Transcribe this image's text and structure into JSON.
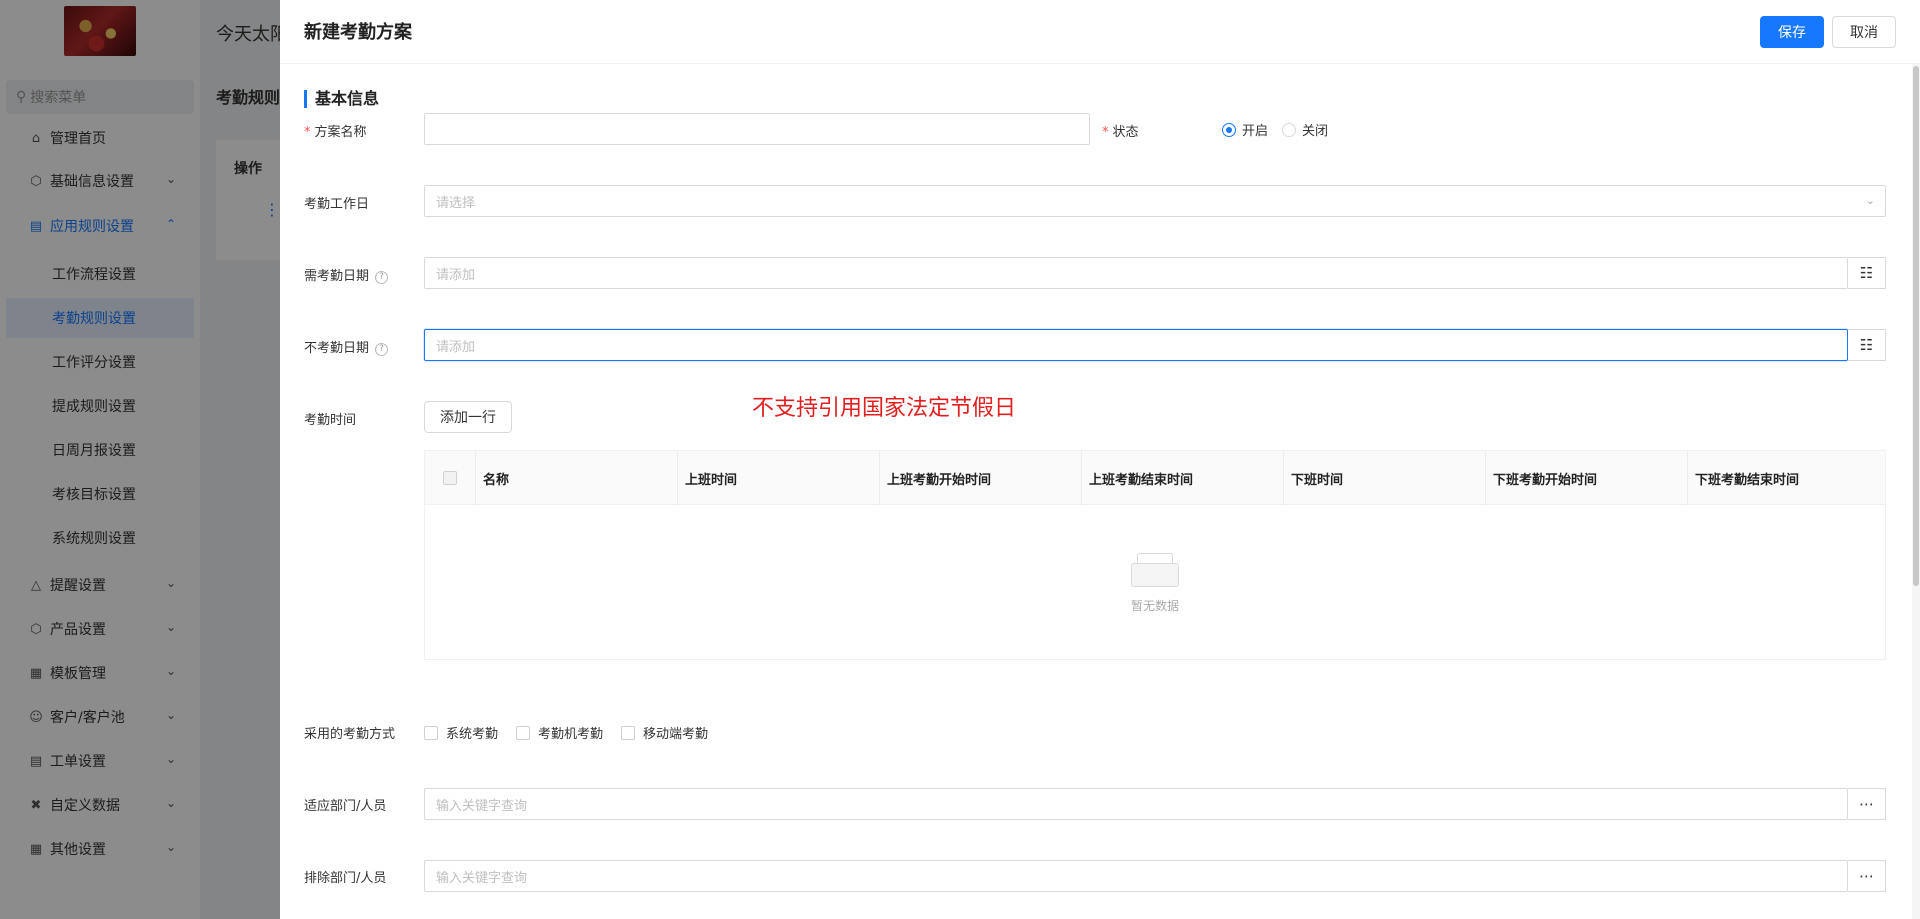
{
  "app": {
    "greeting": "今天太阳",
    "search_placeholder": "搜索菜单",
    "page_title": "考勤规则",
    "table_header_op": "操作",
    "row_action": "⋮"
  },
  "sidebar": {
    "items": [
      {
        "label": "管理首页",
        "icon": "home-icon"
      },
      {
        "label": "基础信息设置",
        "icon": "cube-icon"
      },
      {
        "label": "应用规则设置",
        "icon": "document-icon"
      },
      {
        "label": "提醒设置",
        "icon": "bell-icon"
      },
      {
        "label": "产品设置",
        "icon": "cube-icon"
      },
      {
        "label": "模板管理",
        "icon": "template-icon"
      },
      {
        "label": "客户/客户池",
        "icon": "user-icon"
      },
      {
        "label": "工单设置",
        "icon": "ticket-icon"
      },
      {
        "label": "自定义数据",
        "icon": "tools-icon"
      },
      {
        "label": "其他设置",
        "icon": "grid-icon"
      }
    ],
    "sub_items": [
      {
        "label": "工作流程设置"
      },
      {
        "label": "考勤规则设置"
      },
      {
        "label": "工作评分设置"
      },
      {
        "label": "提成规则设置"
      },
      {
        "label": "日周月报设置"
      },
      {
        "label": "考核目标设置"
      },
      {
        "label": "系统规则设置"
      }
    ]
  },
  "drawer": {
    "title": "新建考勤方案",
    "save_label": "保存",
    "cancel_label": "取消",
    "section_title": "基本信息",
    "fields": {
      "plan_name": {
        "label": "方案名称",
        "value": ""
      },
      "status": {
        "label": "状态",
        "options": [
          "开启",
          "关闭"
        ],
        "selected": "开启"
      },
      "workdays": {
        "label": "考勤工作日",
        "placeholder": "请选择"
      },
      "required_dates": {
        "label": "需考勤日期",
        "placeholder": "请添加"
      },
      "excluded_dates": {
        "label": "不考勤日期",
        "placeholder": "请添加"
      },
      "attendance_time": {
        "label": "考勤时间",
        "add_row_label": "添加一行"
      },
      "methods": {
        "label": "采用的考勤方式",
        "options": [
          "系统考勤",
          "考勤机考勤",
          "移动端考勤"
        ]
      },
      "applicable": {
        "label": "适应部门/人员",
        "placeholder": "输入关键字查询"
      },
      "excluded": {
        "label": "排除部门/人员",
        "placeholder": "输入关键字查询"
      }
    },
    "note": "不支持引用国家法定节假日",
    "table": {
      "columns": [
        "名称",
        "上班时间",
        "上班考勤开始时间",
        "上班考勤结束时间",
        "下班时间",
        "下班考勤开始时间",
        "下班考勤结束时间"
      ],
      "empty_text": "暂无数据"
    }
  },
  "colors": {
    "primary": "#1677ff",
    "required": "#ff4d4f",
    "note": "#e02020"
  }
}
